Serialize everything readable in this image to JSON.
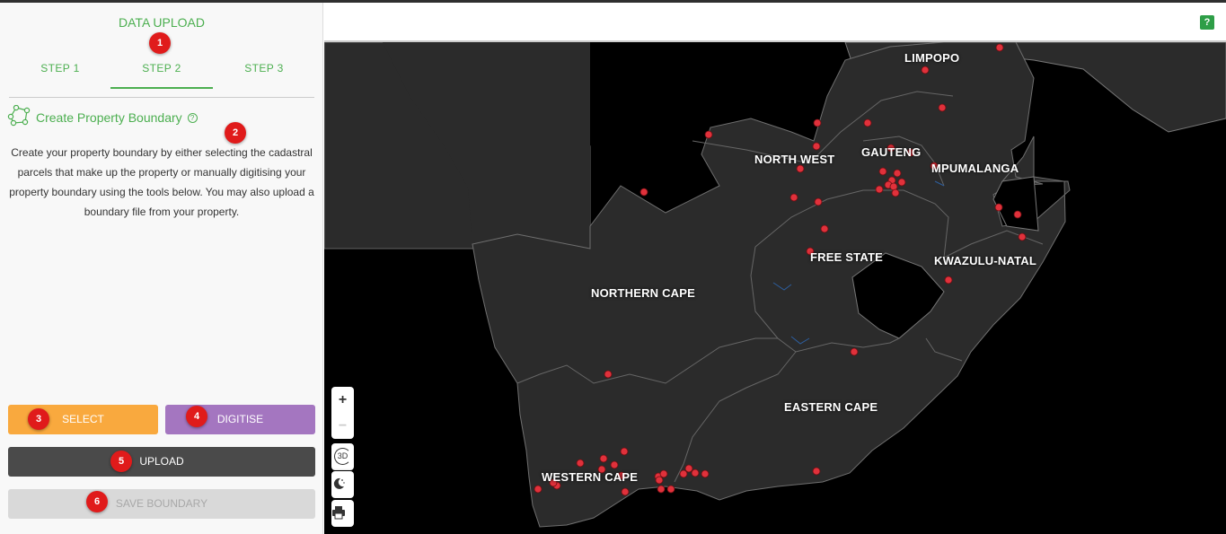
{
  "sidebar": {
    "title": "DATA UPLOAD",
    "steps": [
      {
        "label": "STEP 1"
      },
      {
        "label": "STEP 2"
      },
      {
        "label": "STEP 3"
      }
    ],
    "section_title": "Create Property Boundary",
    "description": "Create your property boundary by either selecting the cadastral parcels that make up the property or manually digitising your property boundary using the tools below. You may also upload a boundary file from your property.",
    "buttons": {
      "select": "SELECT",
      "digitise": "DIGITISE",
      "upload": "UPLOAD",
      "save": "SAVE BOUNDARY"
    }
  },
  "badges": [
    "1",
    "2",
    "3",
    "4",
    "5",
    "6"
  ],
  "header": {
    "help_label": "?"
  },
  "map": {
    "provinces": [
      "LIMPOPO",
      "NORTH WEST",
      "GAUTENG",
      "MPUMALANGA",
      "FREE STATE",
      "KWAZULU-NATAL",
      "NORTHERN CAPE",
      "EASTERN CAPE",
      "WESTERN CAPE"
    ],
    "controls": {
      "zoom_in": "+",
      "zoom_out": "−",
      "view_3d": "3D"
    }
  },
  "colors": {
    "accent": "#4caf50",
    "select": "#f9a93e",
    "digitise": "#a476c0",
    "upload": "#4a4a4a",
    "save": "#d9d9d9",
    "marker": "#e0313b",
    "badge": "#e01b1b"
  }
}
